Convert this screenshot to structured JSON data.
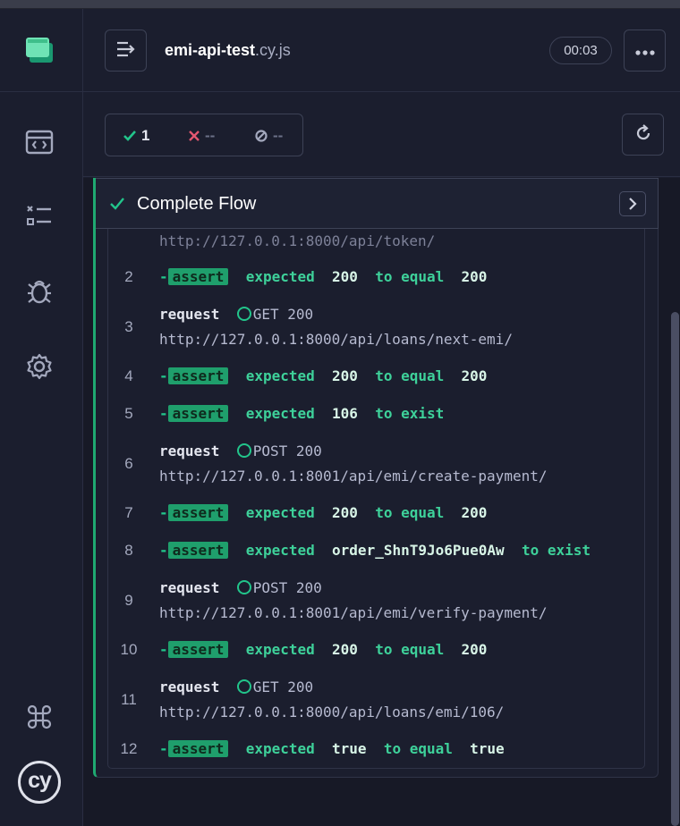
{
  "spec": {
    "name": "emi-api-test",
    "ext": ".cy.js"
  },
  "timer": "00:03",
  "stats": {
    "passed": "1",
    "failed": "--",
    "pending": "--"
  },
  "test": {
    "title": "Complete Flow"
  },
  "commands": {
    "partial_url": "http://127.0.0.1:8000/api/token/",
    "c2": {
      "num": "2",
      "dash": "-",
      "badge": "assert",
      "expected": "expected",
      "v1": "200",
      "mid": "to equal",
      "v2": "200"
    },
    "c3": {
      "num": "3",
      "kw": "request",
      "method": "GET 200",
      "url": "http://127.0.0.1:8000/api/loans/next-emi/"
    },
    "c4": {
      "num": "4",
      "dash": "-",
      "badge": "assert",
      "expected": "expected",
      "v1": "200",
      "mid": "to equal",
      "v2": "200"
    },
    "c5": {
      "num": "5",
      "dash": "-",
      "badge": "assert",
      "expected": "expected",
      "v1": "106",
      "mid": "to exist"
    },
    "c6": {
      "num": "6",
      "kw": "request",
      "method": "POST 200",
      "url": "http://127.0.0.1:8001/api/emi/create-payment/"
    },
    "c7": {
      "num": "7",
      "dash": "-",
      "badge": "assert",
      "expected": "expected",
      "v1": "200",
      "mid": "to equal",
      "v2": "200"
    },
    "c8": {
      "num": "8",
      "dash": "-",
      "badge": "assert",
      "expected": "expected",
      "v1": "order_ShnT9Jo6Pue0Aw",
      "mid": "to exist"
    },
    "c9": {
      "num": "9",
      "kw": "request",
      "method": "POST 200",
      "url": "http://127.0.0.1:8001/api/emi/verify-payment/"
    },
    "c10": {
      "num": "10",
      "dash": "-",
      "badge": "assert",
      "expected": "expected",
      "v1": "200",
      "mid": "to equal",
      "v2": "200"
    },
    "c11": {
      "num": "11",
      "kw": "request",
      "method": "GET 200",
      "url": "http://127.0.0.1:8000/api/loans/emi/106/"
    },
    "c12": {
      "num": "12",
      "dash": "-",
      "badge": "assert",
      "expected": "expected",
      "v1": "true",
      "mid": "to equal",
      "v2": "true"
    }
  },
  "logo": {
    "text": "cy"
  },
  "icons": {
    "app": "app-logo-icon",
    "specs": "browser-window-icon",
    "runs": "checklist-icon",
    "debug": "bug-icon",
    "settings": "gear-icon",
    "shortcuts": "command-key-icon",
    "toggle": "collapse-reporter-icon",
    "menu": "more-options-icon",
    "rerun": "refresh-icon"
  },
  "colors": {
    "pass": "#1fa971",
    "fail": "#e45770",
    "bg": "#1b1e2e"
  }
}
